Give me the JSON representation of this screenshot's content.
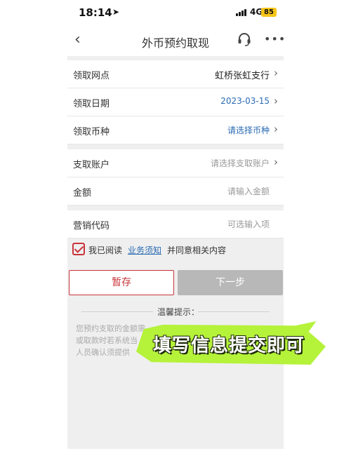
{
  "status_bar": {
    "time": "18:14",
    "network": "4G",
    "battery": "85"
  },
  "header": {
    "title": "外币预约取现",
    "back_icon": "chevron-left-icon",
    "support_icon": "headset-icon",
    "more_label": "•••"
  },
  "form": {
    "branch": {
      "label": "领取网点",
      "value": "虹桥张虹支行"
    },
    "date": {
      "label": "领取日期",
      "value": "2023-03-15"
    },
    "currency": {
      "label": "领取币种",
      "value": "请选择币种"
    },
    "account": {
      "label": "支取账户",
      "placeholder": "请选择支取账户"
    },
    "amount": {
      "label": "金额",
      "placeholder": "请输入金额"
    },
    "promo": {
      "label": "营销代码",
      "placeholder": "可选输入项"
    }
  },
  "agreement": {
    "prefix": "我已阅读",
    "link": "业务须知",
    "suffix": "并同意相关内容"
  },
  "buttons": {
    "save": "暂存",
    "next": "下一步"
  },
  "tips": {
    "title": "温馨提示：",
    "line1": "您预约支取的金额需",
    "line2": "或取款时若系统当",
    "line3": "人员确认须提供"
  },
  "banner": {
    "text": "填写信息提交即可"
  },
  "colors": {
    "accent": "#c8353b",
    "link": "#2a6bb3",
    "banner": "#b5f23a"
  }
}
